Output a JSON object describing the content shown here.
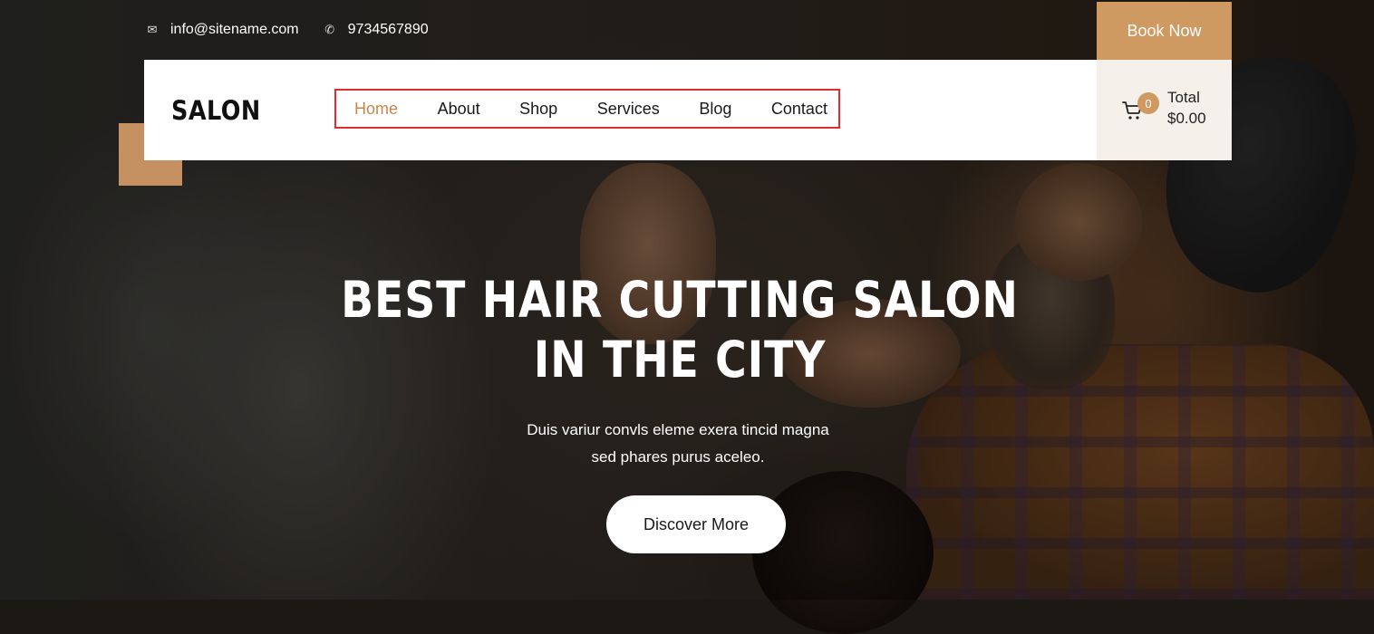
{
  "topbar": {
    "email": "info@sitename.com",
    "phone": "9734567890",
    "email_icon": "envelope-icon",
    "phone_icon": "phone-icon"
  },
  "book_now_label": "Book Now",
  "header": {
    "logo": "SALON",
    "nav": [
      {
        "label": "Home",
        "active": true
      },
      {
        "label": "About",
        "active": false
      },
      {
        "label": "Shop",
        "active": false
      },
      {
        "label": "Services",
        "active": false
      },
      {
        "label": "Blog",
        "active": false
      },
      {
        "label": "Contact",
        "active": false
      }
    ],
    "cart": {
      "icon": "cart-icon",
      "count": "0",
      "total_label": "Total",
      "total_value": "$0.00"
    }
  },
  "hero": {
    "title_line1": "BEST HAIR CUTTING SALON",
    "title_line2": "IN THE CITY",
    "subtitle_line1": "Duis variur convls eleme exera tincid magna",
    "subtitle_line2": "sed phares purus aceleo.",
    "cta": "Discover More"
  },
  "colors": {
    "accent": "#cf9a62",
    "nav_active": "#c8874a",
    "highlight_border": "#e32b32"
  }
}
